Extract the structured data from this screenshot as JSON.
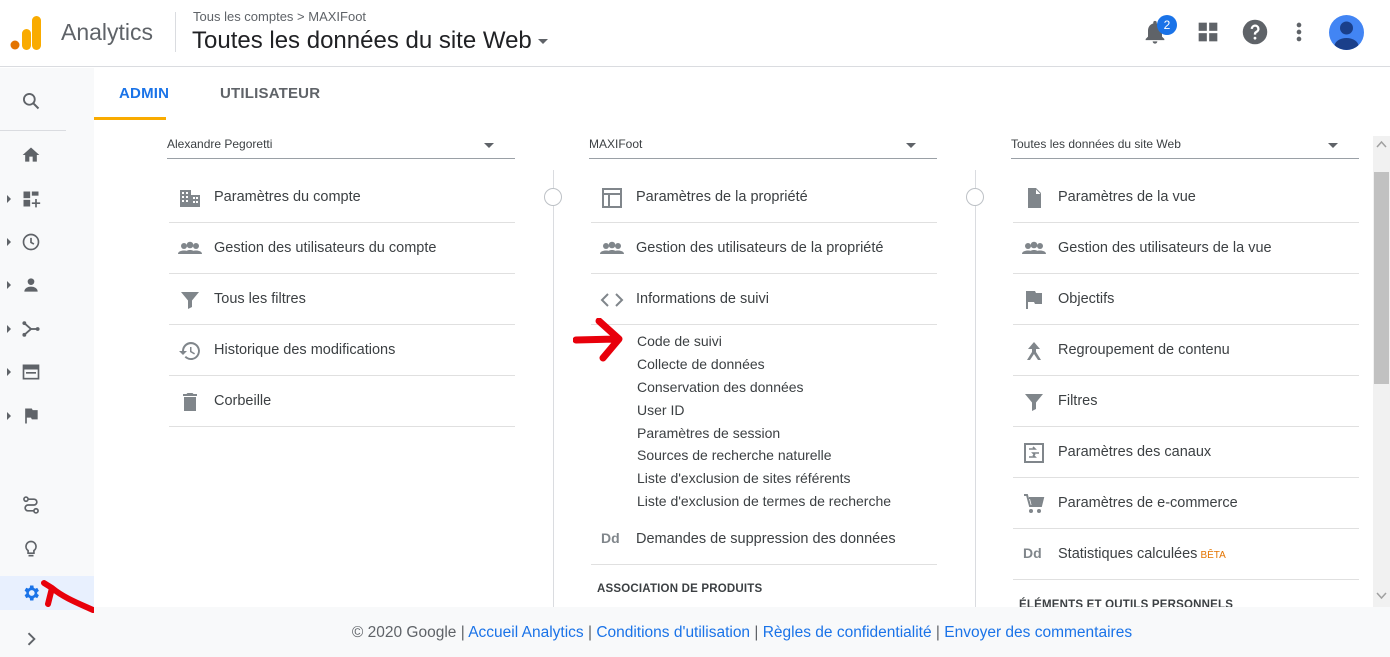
{
  "app": {
    "name": "Analytics"
  },
  "header": {
    "breadcrumb": "Tous les comptes > MAXIFoot",
    "view_title": "Toutes les données du site Web",
    "notification_count": "2"
  },
  "tabs": {
    "admin": "ADMIN",
    "user": "UTILISATEUR"
  },
  "account_col": {
    "selector": "Alexandre Pegoretti",
    "items": [
      "Paramètres du compte",
      "Gestion des utilisateurs du compte",
      "Tous les filtres",
      "Historique des modifications",
      "Corbeille"
    ]
  },
  "property_col": {
    "selector": "MAXIFoot",
    "items": [
      "Paramètres de la propriété",
      "Gestion des utilisateurs de la propriété",
      "Informations de suivi"
    ],
    "tracking_sub": [
      "Code de suivi",
      "Collecte de données",
      "Conservation des données",
      "User ID",
      "Paramètres de session",
      "Sources de recherche naturelle",
      "Liste d'exclusion de sites référents",
      "Liste d'exclusion de termes de recherche"
    ],
    "deletion": "Demandes de suppression des données",
    "section": "ASSOCIATION DE PRODUITS"
  },
  "view_col": {
    "selector": "Toutes les données du site Web",
    "items": [
      "Paramètres de la vue",
      "Gestion des utilisateurs de la vue",
      "Objectifs",
      "Regroupement de contenu",
      "Filtres",
      "Paramètres des canaux",
      "Paramètres de e-commerce",
      "Statistiques calculées"
    ],
    "beta": "BÊTA",
    "section": "ÉLÉMENTS ET OUTILS PERSONNELS"
  },
  "footer": {
    "copyright": "© 2020 Google |",
    "links": [
      "Accueil Analytics",
      "Conditions d'utilisation",
      "Règles de confidentialité",
      "Envoyer des commentaires"
    ],
    "sep": "|"
  },
  "colors": {
    "accent": "#1a73e8",
    "tab_underline": "#f9ab00",
    "annotation": "#e8000b"
  }
}
